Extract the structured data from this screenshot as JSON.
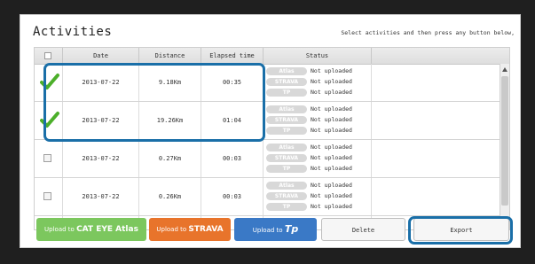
{
  "header": {
    "title": "Activities",
    "instruction": "Select activities and then press any button below,"
  },
  "table": {
    "columns": [
      "Date",
      "Distance",
      "Elapsed time",
      "Status"
    ],
    "rows": [
      {
        "checked": true,
        "date": "2013-07-22",
        "distance": "9.18Km",
        "elapsed": "00:35",
        "status": [
          {
            "service": "Atlas",
            "text": "Not uploaded"
          },
          {
            "service": "STRAVA",
            "text": "Not uploaded"
          },
          {
            "service": "TP",
            "text": "Not uploaded"
          }
        ]
      },
      {
        "checked": true,
        "date": "2013-07-22",
        "distance": "19.26Km",
        "elapsed": "01:04",
        "status": [
          {
            "service": "Atlas",
            "text": "Not uploaded"
          },
          {
            "service": "STRAVA",
            "text": "Not uploaded"
          },
          {
            "service": "TP",
            "text": "Not uploaded"
          }
        ]
      },
      {
        "checked": false,
        "date": "2013-07-22",
        "distance": "0.27Km",
        "elapsed": "00:03",
        "status": [
          {
            "service": "Atlas",
            "text": "Not uploaded"
          },
          {
            "service": "STRAVA",
            "text": "Not uploaded"
          },
          {
            "service": "TP",
            "text": "Not uploaded"
          }
        ]
      },
      {
        "checked": false,
        "date": "2013-07-22",
        "distance": "0.26Km",
        "elapsed": "00:03",
        "status": [
          {
            "service": "Atlas",
            "text": "Not uploaded"
          },
          {
            "service": "STRAVA",
            "text": "Not uploaded"
          },
          {
            "service": "TP",
            "text": "Not uploaded"
          }
        ]
      }
    ]
  },
  "buttons": {
    "cateye_prefix": "Upload to",
    "cateye_brand": "CAT EYE Atlas",
    "strava_prefix": "Upload to",
    "strava_brand": "STRAVA",
    "tp_prefix": "Upload to",
    "tp_brand": "Tp",
    "delete": "Delete",
    "export": "Export"
  },
  "colors": {
    "checkmark": "#4caf2a",
    "highlight": "#1a6fa8",
    "cateye": "#7cc75e",
    "strava": "#e8742b",
    "tp": "#3a79c6"
  }
}
